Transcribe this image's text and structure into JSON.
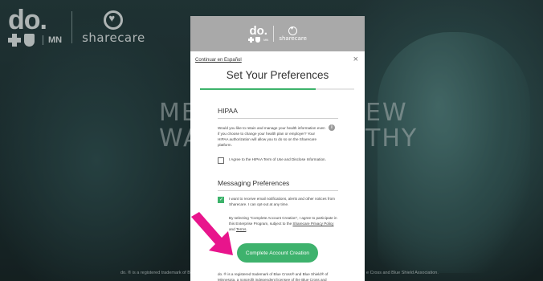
{
  "background": {
    "logo": {
      "do": "do.",
      "mn": "MN",
      "sharecare": "sharecare"
    },
    "headline_left": "ME\nWA",
    "headline_right": "EW\nTHY",
    "footer_left": "do. ® is a registered trademark of B",
    "footer_right": "e Cross and Blue Shield Association."
  },
  "modal": {
    "header": {
      "do": "do.",
      "mn": "MN",
      "sharecare": "sharecare"
    },
    "lang_link": "Continuar en Español",
    "close_symbol": "×",
    "title": "Set Your Preferences",
    "progress_percent": 75,
    "hipaa": {
      "title": "HIPAA",
      "text": "Would you like to retain and manage your health information even if you choose to change your health plan or employer? Your HIPAA authorization will allow you to do so on the Sharecare platform.",
      "info_symbol": "i",
      "checkbox_label": "I Agree to the HIPAA Term of Use and Disclose Information.",
      "checked": false
    },
    "messaging": {
      "title": "Messaging Preferences",
      "checkbox_label": "I want to receive email notifications, alerts and other notices from Sharecare. I can opt-out at any time.",
      "checked": true
    },
    "consent": {
      "text_before": "By selecting \"Complete Account Creation\", I agree to participate in this Enterprise Program, subject to the",
      "privacy_link": "Sharecare Privacy Policy",
      "and": "and",
      "terms_link": "Terms",
      "period": "."
    },
    "cta_label": "Complete Account Creation",
    "trademark": "do. ® is a registered trademark of Blue Cross® and Blue Shield® of Minnesota, a nonprofit independent licensee of the Blue Cross and"
  },
  "colors": {
    "accent_green": "#3eb26d",
    "arrow_pink": "#e8158c",
    "header_gray": "#a9a9a9"
  }
}
